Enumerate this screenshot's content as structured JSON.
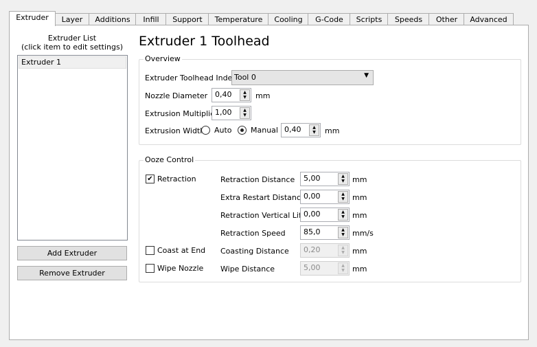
{
  "tabs": [
    "Extruder",
    "Layer",
    "Additions",
    "Infill",
    "Support",
    "Temperature",
    "Cooling",
    "G-Code",
    "Scripts",
    "Speeds",
    "Other",
    "Advanced"
  ],
  "active_tab": "Extruder",
  "extruder_list": {
    "title_line1": "Extruder List",
    "title_line2": "(click item to edit settings)",
    "items": [
      "Extruder 1"
    ],
    "add_button": "Add Extruder",
    "remove_button": "Remove Extruder"
  },
  "heading": "Extruder 1 Toolhead",
  "overview": {
    "title": "Overview",
    "toolhead_index_label": "Extruder Toolhead Index",
    "toolhead_index_value": "Tool 0",
    "nozzle_label": "Nozzle Diameter",
    "nozzle_value": "0,40",
    "nozzle_unit": "mm",
    "multiplier_label": "Extrusion Multiplier",
    "multiplier_value": "1,00",
    "width_label": "Extrusion Width",
    "auto_label": "Auto",
    "manual_label": "Manual",
    "width_value": "0,40",
    "width_unit": "mm",
    "width_mode": "Manual"
  },
  "ooze": {
    "title": "Ooze Control",
    "retraction_label": "Retraction",
    "retraction_checked": true,
    "coast_label": "Coast at End",
    "coast_checked": false,
    "wipe_label": "Wipe Nozzle",
    "wipe_checked": false,
    "fields": [
      {
        "label": "Retraction Distance",
        "value": "5,00",
        "unit": "mm",
        "enabled": true
      },
      {
        "label": "Extra Restart Distance",
        "value": "0,00",
        "unit": "mm",
        "enabled": true
      },
      {
        "label": "Retraction Vertical Lift",
        "value": "0,00",
        "unit": "mm",
        "enabled": true
      },
      {
        "label": "Retraction Speed",
        "value": "85,0",
        "unit": "mm/s",
        "enabled": true
      },
      {
        "label": "Coasting Distance",
        "value": "0,20",
        "unit": "mm",
        "enabled": false
      },
      {
        "label": "Wipe Distance",
        "value": "5,00",
        "unit": "mm",
        "enabled": false
      }
    ]
  }
}
